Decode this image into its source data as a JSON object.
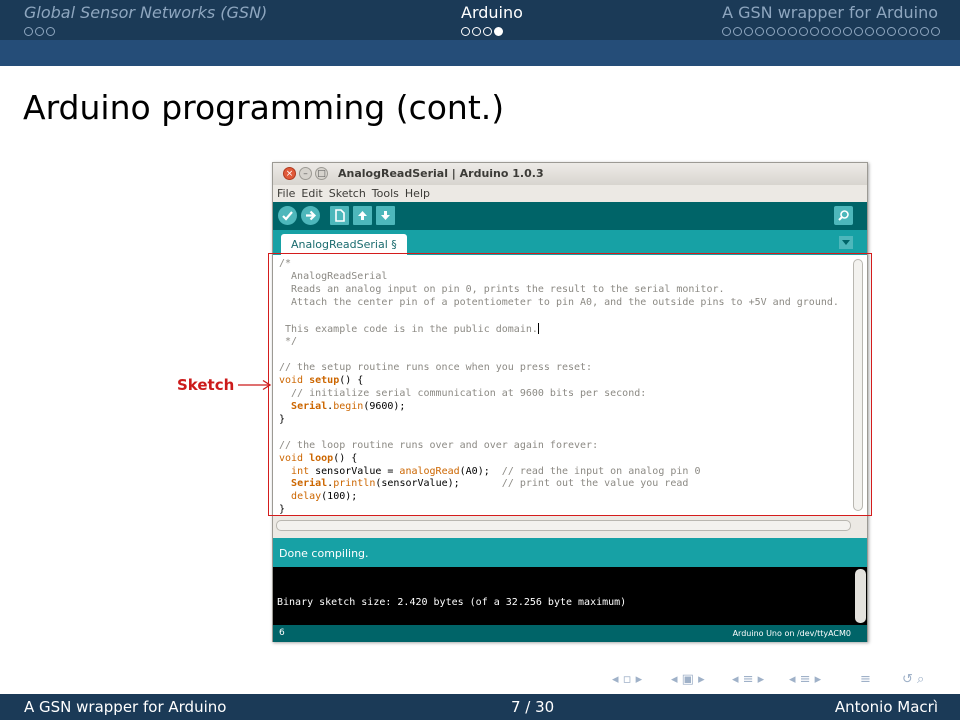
{
  "header": {
    "sections": [
      {
        "title": "Global Sensor Networks (GSN)",
        "dot_count": 3,
        "active_index": -1
      },
      {
        "title": "Arduino",
        "dot_count": 4,
        "active_index": 3
      },
      {
        "title": "A GSN wrapper for Arduino",
        "dot_count": 20,
        "active_index": -1
      }
    ]
  },
  "slide": {
    "title": "Arduino programming (cont.)"
  },
  "annotation": {
    "label": "Sketch",
    "color": "#cc1b1b"
  },
  "ide": {
    "window_title": "AnalogReadSerial | Arduino 1.0.3",
    "menu": [
      "File",
      "Edit",
      "Sketch",
      "Tools",
      "Help"
    ],
    "toolbar_icons": [
      "verify-icon",
      "upload-icon",
      "new-icon",
      "open-icon",
      "save-icon",
      "serial-monitor-icon"
    ],
    "tab_label": "AnalogReadSerial §",
    "code_lines": [
      "/*",
      "  AnalogReadSerial",
      "  Reads an analog input on pin 0, prints the result to the serial monitor.",
      "  Attach the center pin of a potentiometer to pin A0, and the outside pins to +5V and ground.",
      "",
      " This example code is in the public domain.",
      " */",
      "",
      "// the setup routine runs once when you press reset:",
      "void setup() {",
      "  // initialize serial communication at 9600 bits per second:",
      "  Serial.begin(9600);",
      "}",
      "",
      "// the loop routine runs over and over again forever:",
      "void loop() {",
      "  int sensorValue = analogRead(A0);  // read the input on analog pin 0",
      "  Serial.println(sensorValue);       // print out the value you read",
      "  delay(100);",
      "}"
    ],
    "status_text": "Done compiling.",
    "console_text": "Binary sketch size: 2.420 bytes (of a 32.256 byte maximum)",
    "line_number": "6",
    "board_info": "Arduino Uno on /dev/ttyACM0",
    "colors": {
      "teal_dark": "#006468",
      "teal_light": "#17a1a5",
      "keyword": "#cc6600",
      "comment": "#8c8a84"
    }
  },
  "footer": {
    "left": "A GSN wrapper for Arduino",
    "center": "7 / 30",
    "right": "Antonio Macrì"
  },
  "nav_icons": [
    "nav-frame-icon",
    "nav-subsection-icon",
    "nav-section-icon",
    "nav-document-icon",
    "nav-search-icon"
  ],
  "theme": {
    "header_dark": "#1b3a57",
    "header_bar": "#254d78",
    "header_dim_text": "#8ea6bf"
  }
}
